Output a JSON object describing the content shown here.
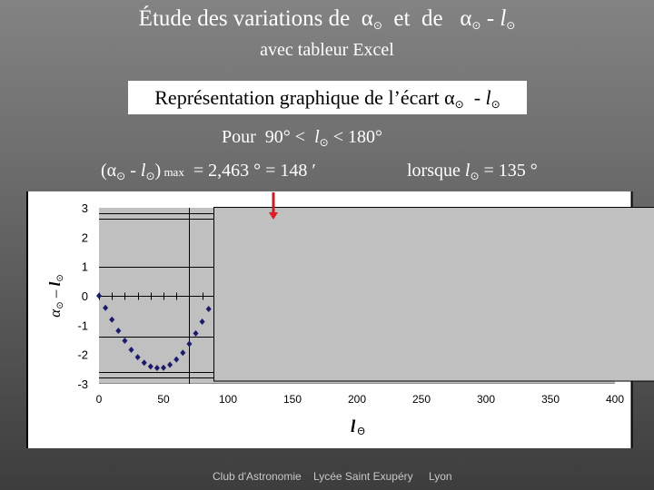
{
  "header": {
    "title": {
      "part1": "Étude des variations de  ",
      "alpha": "α",
      "sun": "⊙",
      "part2": "  et  de   ",
      "minus": " - ",
      "l": "l"
    },
    "subtitle": "avec tableur Excel",
    "banner": {
      "text": "Représentation graphique de l’écart ",
      "alpha": "α",
      "sun": "⊙",
      "minus": "  - ",
      "l": "l"
    },
    "range": {
      "prefix": "Pour  90° <  ",
      "l": "l",
      "sun": "⊙",
      "suffix": " < 180°"
    },
    "maximum": {
      "open": "(",
      "alpha": "α",
      "sun": "⊙",
      "minus": " - ",
      "l": "l",
      "close": ")",
      "qualifier": " max",
      "value": "  = 2,463 ° = 148 ′",
      "condition": "lorsque ",
      "condition_l": "l",
      "condition_value": " = 135 °"
    }
  },
  "chart_data": {
    "type": "scatter",
    "title": "",
    "xlabel": "l",
    "xlabel_subscript": "Θ",
    "ylabel": {
      "alpha": "α",
      "sun": "⊙",
      "minus": " – ",
      "l": "l"
    },
    "xlim": [
      0,
      400
    ],
    "ylim": [
      -3,
      3
    ],
    "x_tick_values": [
      0,
      50,
      100,
      150,
      200,
      250,
      300,
      350,
      400
    ],
    "x_tick_labels": [
      "0",
      "50",
      "100",
      "150",
      "200",
      "250",
      "300",
      "350",
      "400"
    ],
    "y_tick_values": [
      3,
      2,
      1,
      0,
      -1,
      -2,
      -3
    ],
    "y_tick_labels": [
      "3",
      "2",
      "1",
      "0",
      "-1",
      "-2",
      "-3"
    ],
    "zero_axis_minor_tick_step": 10,
    "grid": false,
    "legend": "none",
    "series": [
      {
        "name": "α⊙ - l⊙",
        "marker": "diamond",
        "x": [
          0,
          5,
          10,
          15,
          20,
          25,
          30,
          35,
          40,
          45,
          50,
          55,
          60,
          65,
          70,
          75,
          80,
          85
        ],
        "y": [
          0,
          -0.41,
          -0.81,
          -1.19,
          -1.53,
          -1.84,
          -2.09,
          -2.28,
          -2.41,
          -2.46,
          -2.45,
          -2.35,
          -2.17,
          -1.94,
          -1.64,
          -1.28,
          -0.88,
          -0.45
        ]
      }
    ],
    "reference_lines": {
      "horizontal": [
        2.8,
        2.63,
        1.0,
        -1.39,
        -2.6,
        -2.79
      ],
      "vertical": [
        70
      ]
    },
    "annotations": [
      {
        "type": "arrow",
        "x": 135,
        "direction": "down"
      }
    ]
  },
  "colors": {
    "marker": "#1b1b6b",
    "plot_background": "#c0c0c0",
    "arrow": "#c41e2a",
    "arrow_head": "#e11b26",
    "footer_text": "#c8c8c8"
  },
  "footer": {
    "items": [
      "Club d'Astronomie",
      "Lycée Saint Exupéry",
      "Lyon"
    ]
  }
}
